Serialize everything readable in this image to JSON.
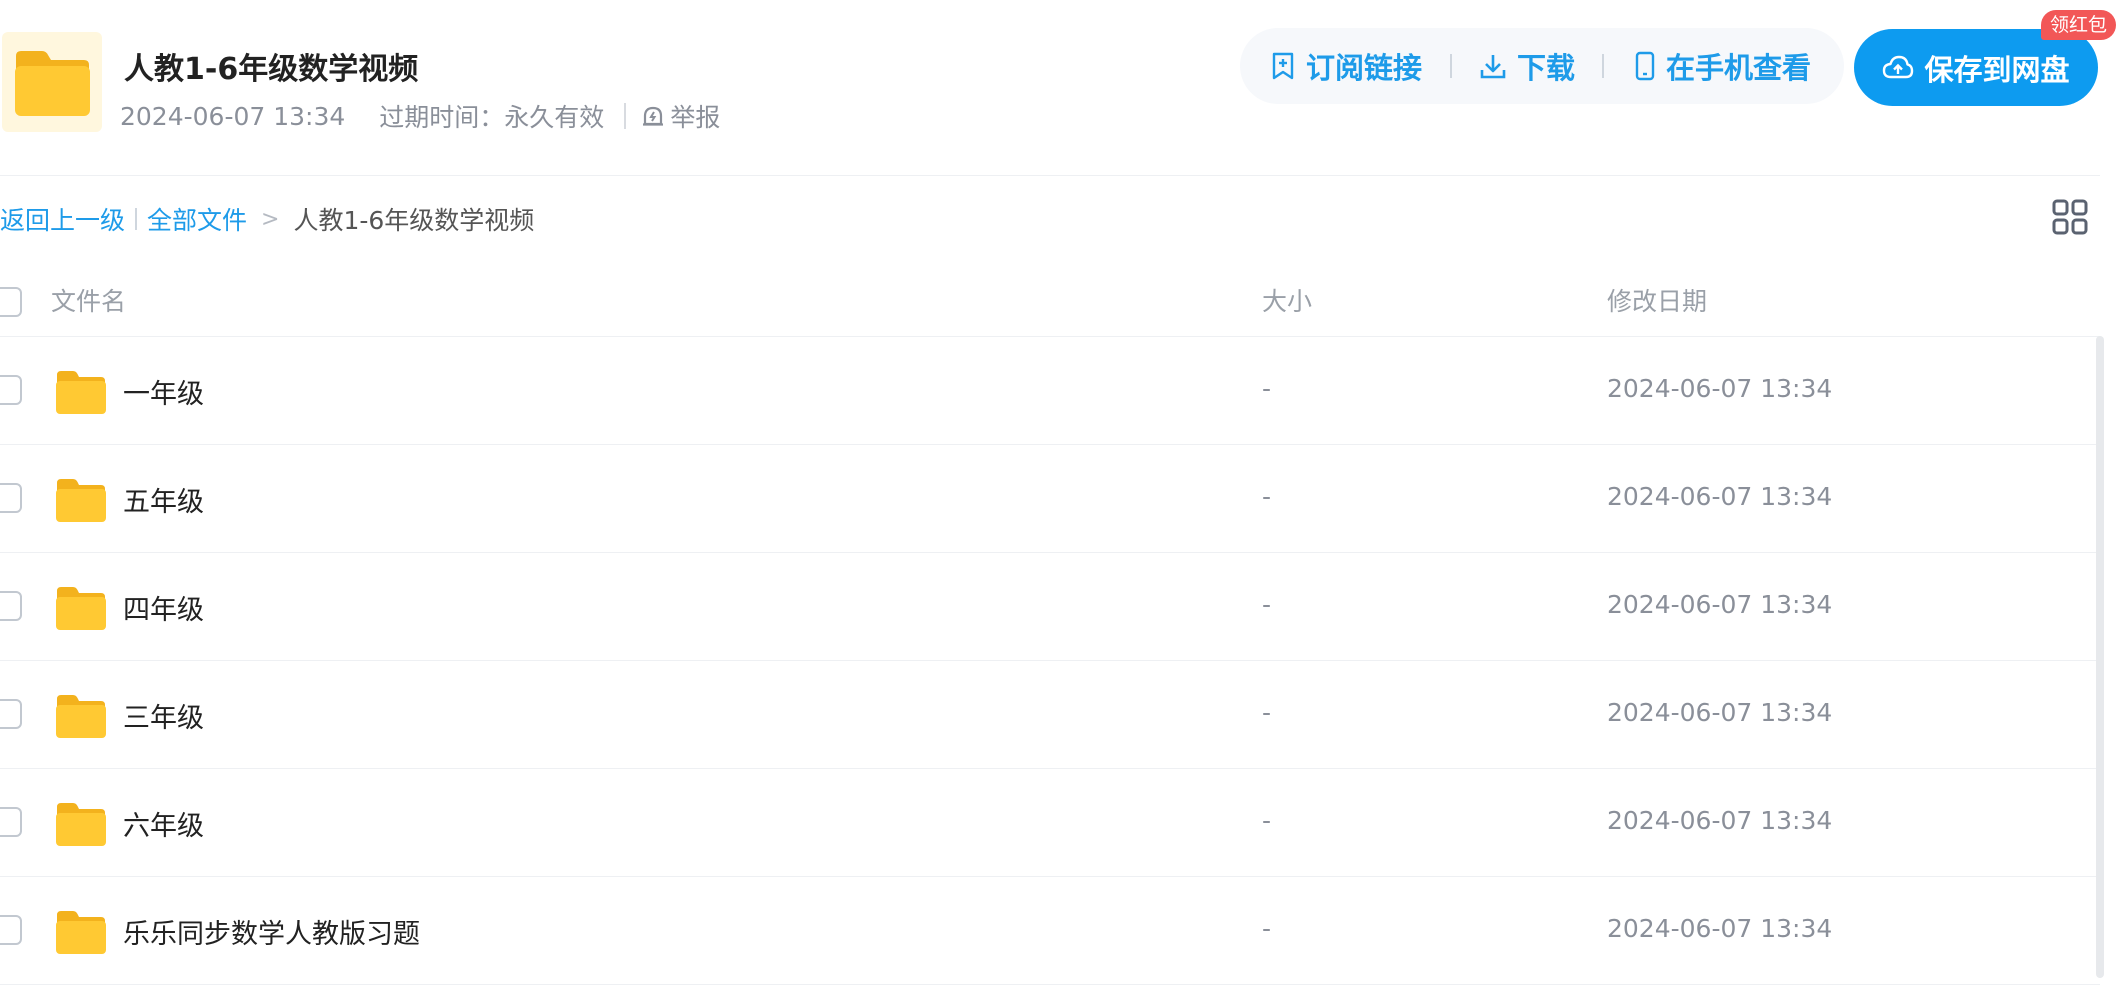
{
  "share": {
    "title": "人教1-6年级数学视频",
    "date": "2024-06-07 13:34",
    "expire_label": "过期时间：",
    "expire_value": "永久有效",
    "report_label": "举报"
  },
  "actions": {
    "subscribe": "订阅链接",
    "download": "下载",
    "mobile": "在手机查看",
    "save": "保存到网盘",
    "badge": "领红包"
  },
  "breadcrumb": {
    "back": "返回上一级",
    "all_files": "全部文件",
    "separator": ">",
    "current": "人教1-6年级数学视频"
  },
  "table": {
    "headers": {
      "name": "文件名",
      "size": "大小",
      "date": "修改日期"
    },
    "rows": [
      {
        "name": "一年级",
        "size": "-",
        "date": "2024-06-07 13:34"
      },
      {
        "name": "五年级",
        "size": "-",
        "date": "2024-06-07 13:34"
      },
      {
        "name": "四年级",
        "size": "-",
        "date": "2024-06-07 13:34"
      },
      {
        "name": "三年级",
        "size": "-",
        "date": "2024-06-07 13:34"
      },
      {
        "name": "六年级",
        "size": "-",
        "date": "2024-06-07 13:34"
      },
      {
        "name": "乐乐同步数学人教版习题",
        "size": "-",
        "date": "2024-06-07 13:34"
      }
    ]
  },
  "colors": {
    "accent": "#1e9be9",
    "save_button": "#0d9bf0",
    "badge": "#f25757",
    "folder": "#ffc933"
  },
  "icons": {
    "share_folder": "folder-icon",
    "subscribe": "bookmark-plus-icon",
    "download": "download-icon",
    "mobile": "phone-icon",
    "save": "cloud-upload-icon",
    "report": "alarm-icon",
    "view_toggle": "grid-view-icon",
    "row": "folder-icon"
  }
}
